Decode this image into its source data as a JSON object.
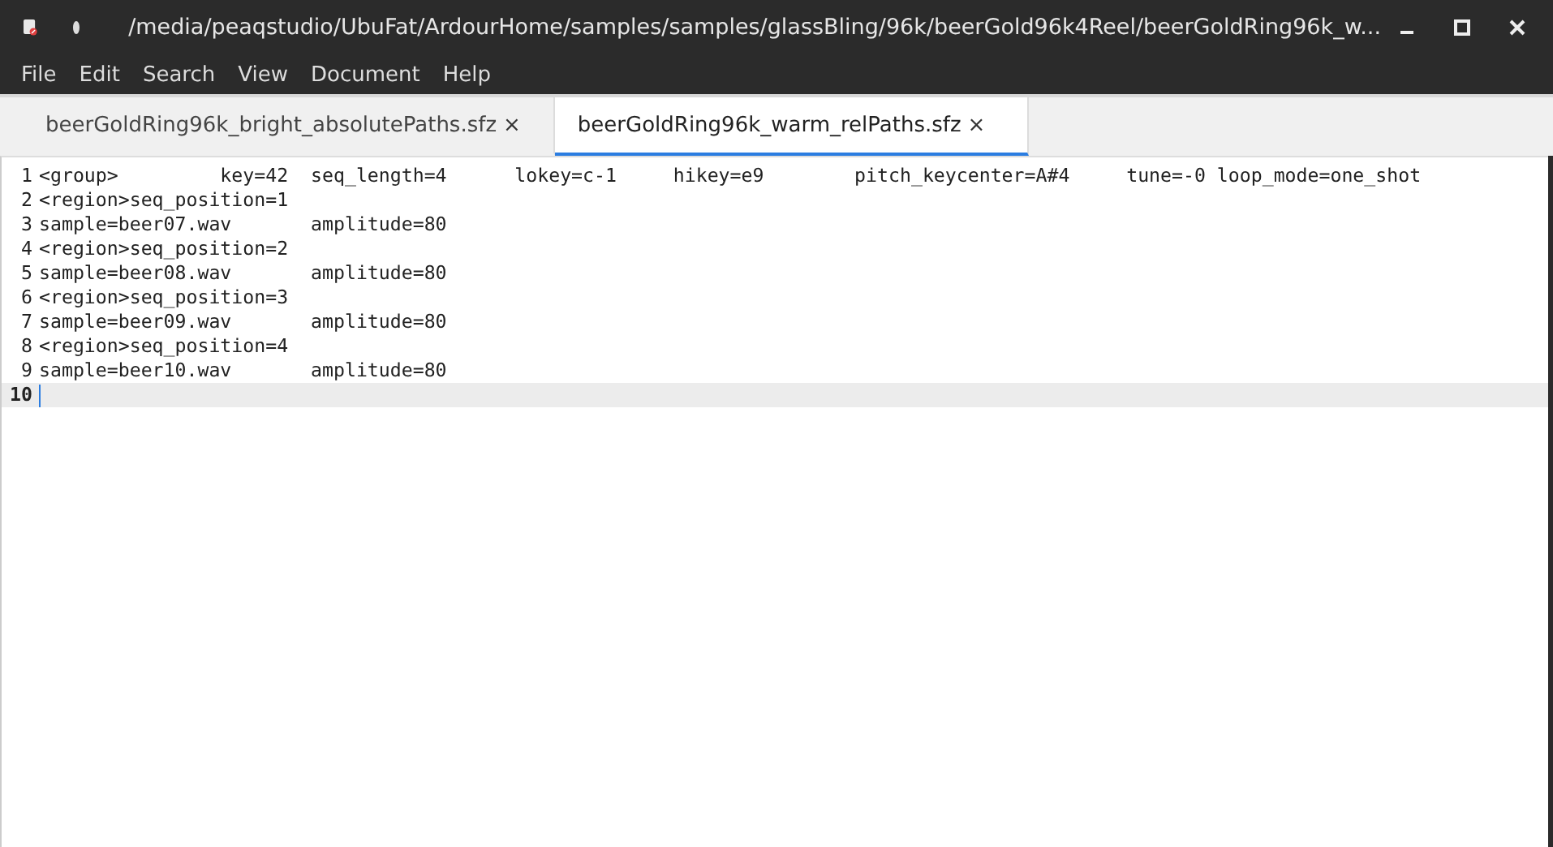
{
  "window": {
    "title": "/media/peaqstudio/UbuFat/ArdourHome/samples/samples/glassBling/96k/beerGold96k4Reel/beerGoldRing96k_w...",
    "modified": true
  },
  "menu": [
    "File",
    "Edit",
    "Search",
    "View",
    "Document",
    "Help"
  ],
  "tabs": [
    {
      "label": "beerGoldRing96k_bright_absolutePaths.sfz",
      "close": "×",
      "selected": false
    },
    {
      "label": "beerGoldRing96k_warm_relPaths.sfz",
      "close": "×",
      "selected": true
    }
  ],
  "lines": [
    {
      "number": "1",
      "text": "<group>         key=42  seq_length=4      lokey=c-1     hikey=e9        pitch_keycenter=A#4     tune=-0 loop_mode=one_shot",
      "current": false
    },
    {
      "number": "2",
      "text": "<region>seq_position=1",
      "current": false
    },
    {
      "number": "3",
      "text": "sample=beer07.wav       amplitude=80",
      "current": false
    },
    {
      "number": "4",
      "text": "<region>seq_position=2",
      "current": false
    },
    {
      "number": "5",
      "text": "sample=beer08.wav       amplitude=80",
      "current": false
    },
    {
      "number": "6",
      "text": "<region>seq_position=3",
      "current": false
    },
    {
      "number": "7",
      "text": "sample=beer09.wav       amplitude=80",
      "current": false
    },
    {
      "number": "8",
      "text": "<region>seq_position=4",
      "current": false
    },
    {
      "number": "9",
      "text": "sample=beer10.wav       amplitude=80",
      "current": false
    },
    {
      "number": "10",
      "current": true
    }
  ]
}
